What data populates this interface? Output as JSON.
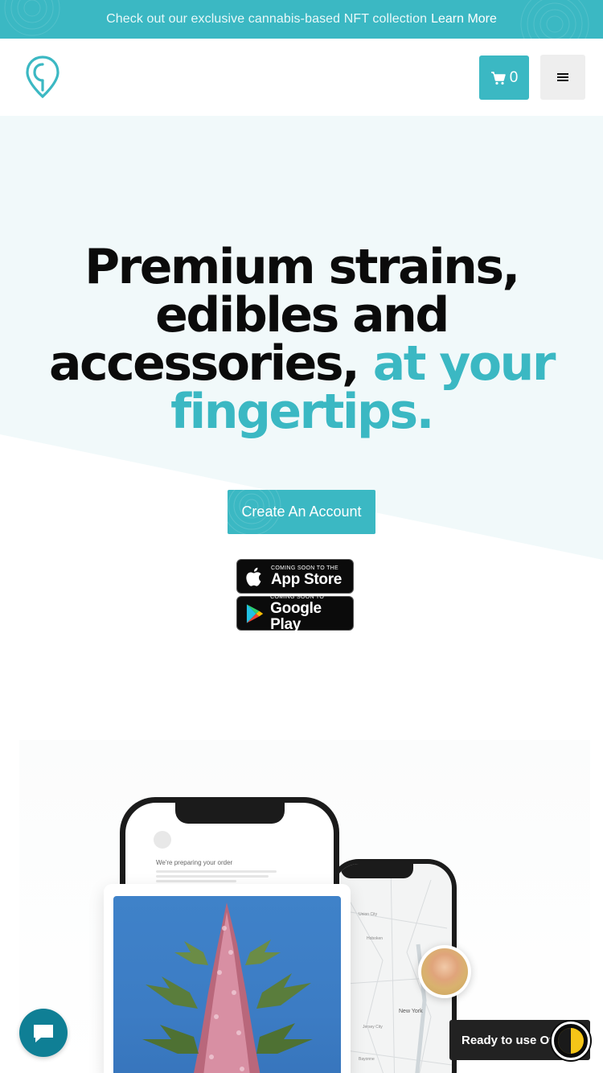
{
  "announcement": {
    "message": "Check out our exclusive cannabis-based NFT collection",
    "link_label": "Learn More"
  },
  "header": {
    "logo_icon": "location-pin-logo-icon",
    "cart_count": "0",
    "cart_icon": "cart-icon",
    "menu_icon": "hamburger-menu-icon"
  },
  "hero": {
    "headline_part1": "Premium strains, edibles and accessories, ",
    "headline_accent": "at your fingertips.",
    "cta_label": "Create An Account",
    "app_store": {
      "small": "COMING SOON TO THE",
      "big": "App Store"
    },
    "google_play": {
      "small": "COMING SOON TO",
      "big": "Google Play"
    }
  },
  "mockup": {
    "order_title": "We're preparing your order",
    "map_labels": [
      "New York",
      "Hoboken",
      "Union City",
      "Bayonne",
      "Jersey City"
    ]
  },
  "widgets": {
    "chat_icon": "chat-bubble-icon",
    "ready_label": "Ready to use Of",
    "moon_icon": "half-moon-icon"
  },
  "colors": {
    "accent": "#3bb8c3",
    "hero_bg": "#f1f9fa",
    "chat": "#0f7f95",
    "dark": "#222222"
  }
}
